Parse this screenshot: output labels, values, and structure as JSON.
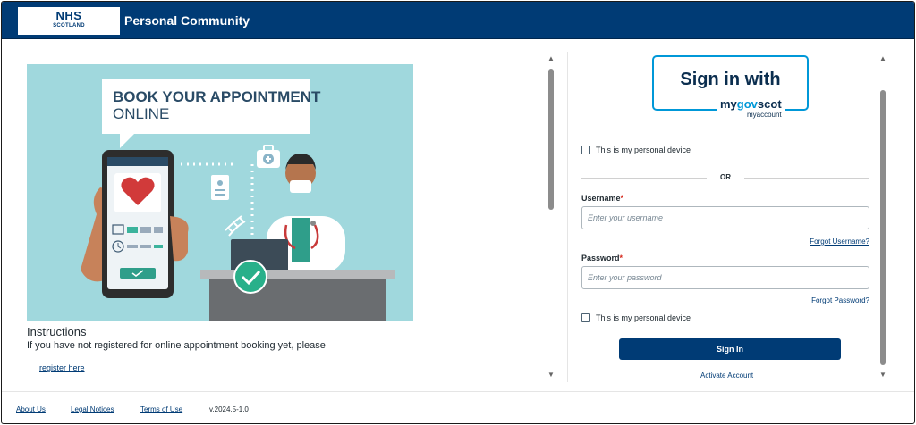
{
  "header": {
    "logo": {
      "line1": "NHS",
      "line2": "SCOTLAND"
    },
    "title": "Personal Community"
  },
  "promo": {
    "headline1": "BOOK YOUR APPOINTMENT",
    "headline2": "ONLINE"
  },
  "instructions": {
    "title": "Instructions",
    "text": "If you have not registered for online appointment booking yet, please",
    "link": "register here"
  },
  "signin": {
    "mygov_line1": "Sign in with",
    "mygov_brand_my": "my",
    "mygov_brand_gov": "gov",
    "mygov_brand_scot": "scot",
    "mygov_account": "myaccount",
    "personal_device_label": "This is my personal device",
    "or_text": "OR",
    "username_label": "Username",
    "username_placeholder": "Enter your username",
    "forgot_username": "Forgot Username?",
    "password_label": "Password",
    "password_placeholder": "Enter your password",
    "forgot_password": "Forgot Password?",
    "personal_device_label_2": "This is my personal device",
    "signin_button": "Sign In",
    "activate_account": "Activate Account",
    "required_marker": "*"
  },
  "footer": {
    "about": "About Us",
    "legal": "Legal Notices",
    "terms": "Terms of Use",
    "version": "v.2024.5-1.0"
  },
  "colors": {
    "brand": "#003b75",
    "promo_bg": "#a0d8dd",
    "mygov_blue": "#0098d8",
    "required": "#d5281b"
  },
  "icons": [
    "arrow-up-icon",
    "arrow-down-icon",
    "heart-icon",
    "check-circle-icon",
    "medical-kit-icon",
    "document-icon",
    "dna-icon",
    "clock-icon",
    "calendar-icon"
  ]
}
